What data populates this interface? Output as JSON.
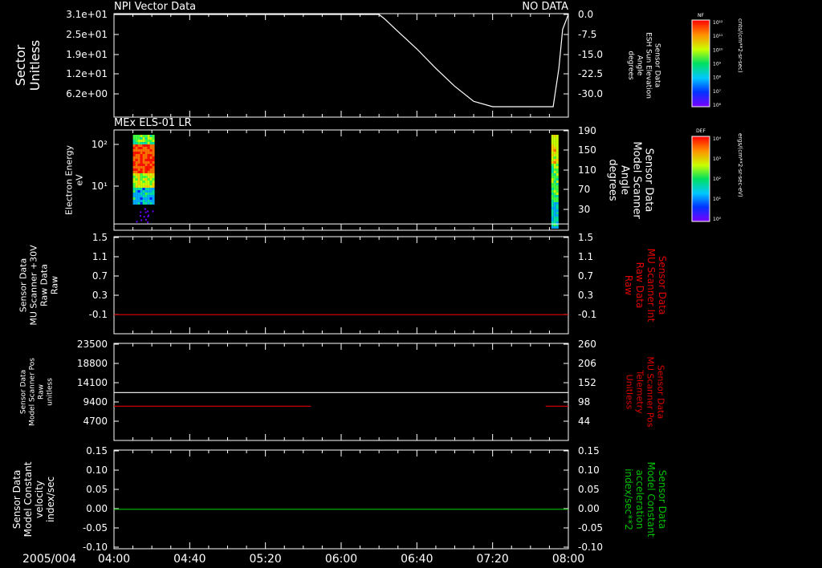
{
  "xaxis": {
    "date_label": "2005/004",
    "tick_labels": [
      "04:00",
      "04:40",
      "05:20",
      "06:00",
      "06:40",
      "07:20",
      "08:00"
    ],
    "range": [
      "04:00",
      "08:00"
    ]
  },
  "colors": {
    "background": "#000000",
    "frame": "#ffffff",
    "red_trace": "#e00000",
    "green_trace": "#00c000"
  },
  "colorbars": [
    {
      "tag": "NF",
      "units": "cnts/(cm**2-sr-sec)",
      "tick_labels": [
        "10¹²",
        "10¹¹",
        "10¹⁰",
        "10⁹",
        "10⁸",
        "10⁷",
        "10⁶"
      ]
    },
    {
      "tag": "DEF",
      "units": "ergs/(cm**2-sr-sec-eV)",
      "tick_labels": [
        "10⁴",
        "10³",
        "10²",
        "10¹",
        "10⁰"
      ]
    }
  ],
  "chart_data": [
    {
      "type": "line",
      "title_left": "NPI Vector Data",
      "title_right": "NO DATA",
      "ylabel_left": [
        "Sector",
        "Unitless"
      ],
      "left_tick_labels": [
        "3.1e+01",
        "2.5e+01",
        "1.9e+01",
        "1.2e+01",
        "6.2e+00"
      ],
      "ylabel_right": [
        "Sensor Data",
        "ESH Sun Elevation",
        "Angle",
        "degrees"
      ],
      "right_tick_labels": [
        "0.0",
        "-7.5",
        "-15.0",
        "-22.5",
        "-30.0"
      ],
      "ylim_right": [
        -34,
        0
      ],
      "series": [
        {
          "color": "#ffffff",
          "x_minutes": [
            0,
            60,
            140,
            143,
            150,
            160,
            170,
            180,
            190,
            200,
            210,
            220,
            232,
            235,
            237,
            240
          ],
          "y": [
            0,
            0,
            0,
            -1.5,
            -5.7,
            -11.5,
            -18,
            -24,
            -29,
            -30.8,
            -30.8,
            -30.8,
            -30.8,
            -18,
            -5,
            0
          ]
        }
      ]
    },
    {
      "type": "heatmap",
      "title_left": "MEx ELS-01 LR",
      "ylabel_left": [
        "Electron Energy",
        "eV"
      ],
      "left_tick_labels": [
        "10²",
        "10¹"
      ],
      "ylabel_right": [
        "Sensor Data",
        "Model Scanner",
        "Angle",
        "degrees"
      ],
      "right_tick_labels": [
        "190",
        "150",
        "110",
        "70",
        "30"
      ],
      "ylim_right": [
        0,
        190
      ],
      "reference_line": 12,
      "blocks_minutes": [
        [
          10,
          20.5
        ],
        [
          231,
          234
        ]
      ]
    },
    {
      "type": "line",
      "ylabel_left": [
        "Sensor Data",
        "MU Scanner +30V",
        "Raw Data",
        "Raw"
      ],
      "left_tick_labels": [
        "1.5",
        "1.1",
        "0.7",
        "0.3",
        "-0.1"
      ],
      "ylim": [
        -0.33,
        1.5
      ],
      "ylabel_right": [
        "Sensor Data",
        "MU Scanner Int",
        "Raw Data",
        "Raw"
      ],
      "right_tick_labels": [
        "1.5",
        "1.1",
        "0.7",
        "0.3",
        "-0.1"
      ],
      "series": [
        {
          "color": "#e00000",
          "x_minutes": [
            0,
            240
          ],
          "y": [
            0.03,
            0.03
          ]
        }
      ]
    },
    {
      "type": "line",
      "ylabel_left": [
        "Sensor Data",
        "Model Scanner Pos",
        "Raw",
        "unitless"
      ],
      "left_tick_labels": [
        "23500",
        "18800",
        "14100",
        "9400",
        "4700"
      ],
      "ylim": [
        0,
        23500
      ],
      "ylabel_right": [
        "Sensor Data",
        "MU Scanner Pos",
        "Telemetry",
        "Unitless"
      ],
      "right_tick_labels": [
        "260",
        "206",
        "152",
        "98",
        "44"
      ],
      "ylim_right": [
        0,
        260
      ],
      "series": [
        {
          "color": "#ffffff",
          "x_minutes": [
            0,
            240
          ],
          "y": [
            11600,
            11600
          ]
        },
        {
          "color": "#e00000",
          "x_minutes": [
            0,
            104
          ],
          "y": [
            8300,
            8300
          ]
        },
        {
          "color": "#e00000",
          "x_minutes": [
            228,
            240
          ],
          "y": [
            8300,
            8300
          ]
        }
      ]
    },
    {
      "type": "line",
      "ylabel_left": [
        "Sensor Data",
        "Model Constant",
        "velocity",
        "index/sec"
      ],
      "left_tick_labels": [
        "0.15",
        "0.10",
        "0.05",
        "0.00",
        "-0.05",
        "-0.10"
      ],
      "ylim": [
        -0.1,
        0.15
      ],
      "ylabel_right": [
        "Sensor Data",
        "Model Constant",
        "acceleration",
        "index/sec**2"
      ],
      "right_tick_labels": [
        "0.15",
        "0.10",
        "0.05",
        "0.00",
        "-0.05",
        "-0.10"
      ],
      "series": [
        {
          "color": "#00c000",
          "x_minutes": [
            0,
            240
          ],
          "y": [
            0,
            0
          ]
        }
      ]
    }
  ]
}
